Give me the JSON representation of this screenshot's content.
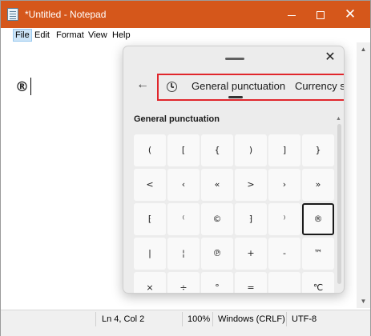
{
  "notepad": {
    "title": "*Untitled - Notepad",
    "menu": [
      "File",
      "Edit",
      "Format",
      "View",
      "Help"
    ],
    "content": "®",
    "status": {
      "position": "Ln 4, Col 2",
      "zoom": "100%",
      "line_ending": "Windows (CRLF)",
      "encoding": "UTF-8"
    }
  },
  "emoji_panel": {
    "tabs": [
      "General punctuation",
      "Currency s"
    ],
    "section_title": "General punctuation",
    "symbols": [
      [
        "(",
        "[",
        "{",
        ")",
        "]",
        "}"
      ],
      [
        "<",
        "‹",
        "«",
        ">",
        "›",
        "»"
      ],
      [
        "⁅",
        "⁽",
        "©",
        "⁆",
        "⁾",
        "®"
      ],
      [
        "|",
        "¦",
        "℗",
        "+",
        "-",
        "™"
      ],
      [
        "×",
        "÷",
        "°",
        "=",
        "",
        "℃"
      ]
    ],
    "selected_symbol": "®",
    "accent_color": "#e0262c"
  }
}
